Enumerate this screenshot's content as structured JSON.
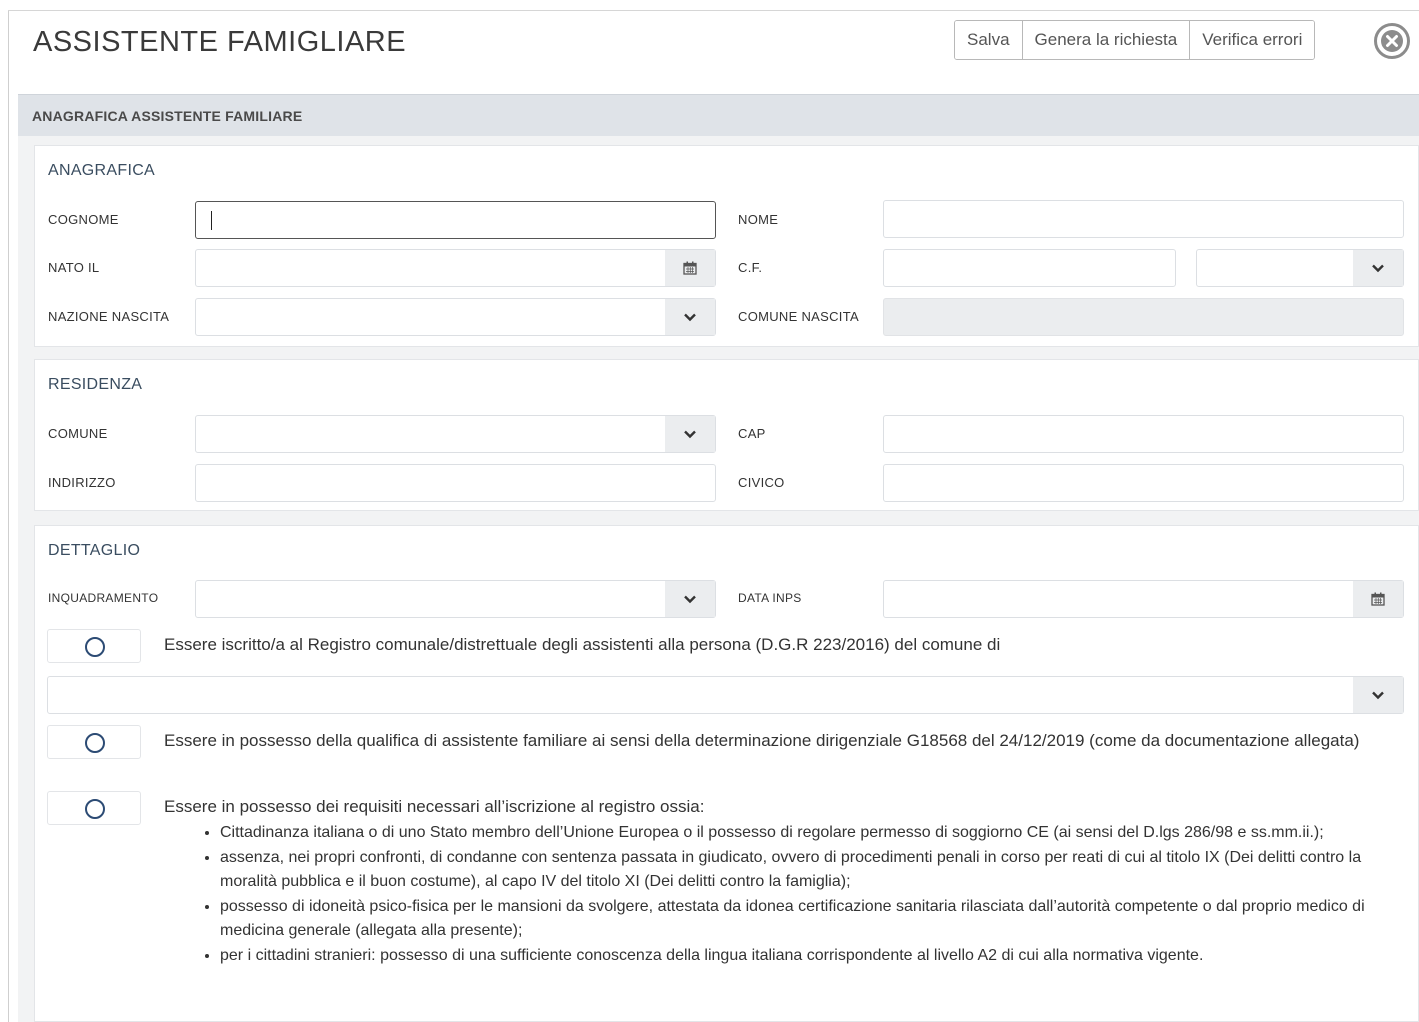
{
  "header": {
    "title": "ASSISTENTE FAMIGLIARE",
    "buttons": {
      "save": "Salva",
      "generate": "Genera la richiesta",
      "verify": "Verifica errori"
    }
  },
  "section": {
    "title": "ANAGRAFICA ASSISTENTE FAMILIARE"
  },
  "anagrafica": {
    "title": "ANAGRAFICA",
    "cognome_label": "COGNOME",
    "nome_label": "NOME",
    "nato_il_label": "NATO IL",
    "cf_label": "C.F.",
    "nazione_nascita_label": "NAZIONE NASCITA",
    "comune_nascita_label": "COMUNE NASCITA"
  },
  "residenza": {
    "title": "RESIDENZA",
    "comune_label": "COMUNE",
    "cap_label": "CAP",
    "indirizzo_label": "INDIRIZZO",
    "civico_label": "CIVICO"
  },
  "dettaglio": {
    "title": "DETTAGLIO",
    "inquadramento_label": "INQUADRAMENTO",
    "data_inps_label": "DATA INPS",
    "req1": "Essere iscritto/a al Registro comunale/distrettuale degli assistenti alla persona (D.G.R 223/2016) del comune di",
    "req2": "Essere in possesso della qualifica di assistente familiare ai sensi della determinazione dirigenziale G18568 del 24/12/2019 (come da documentazione allegata)",
    "req3": "Essere in possesso dei requisiti necessari all’iscrizione al registro ossia:",
    "req3_items": [
      "Cittadinanza italiana o di uno Stato membro dell’Unione Europea o il possesso di regolare permesso di soggiorno CE (ai sensi del D.lgs 286/98 e ss.mm.ii.);",
      "assenza, nei propri confronti, di condanne con sentenza passata in giudicato, ovvero di procedimenti penali in corso per reati di cui al titolo IX (Dei delitti contro la moralità pubblica e il buon costume), al capo IV del titolo XI (Dei delitti contro la famiglia);",
      "possesso di idoneità psico-fisica per le mansioni da svolgere, attestata da idonea certificazione sanitaria rilasciata dall’autorità competente o dal proprio medico di medicina generale (allegata alla presente);",
      "per i cittadini stranieri: possesso di una sufficiente conoscenza della lingua italiana corrispondente al livello A2 di cui alla normativa vigente."
    ]
  },
  "icons": {
    "close": "close-circle-icon",
    "calendar": "calendar-icon",
    "dropdown": "chevron-down-icon",
    "toggle": "radio-circle-icon"
  },
  "colors": {
    "section_bar": "#dfe3e8",
    "card_title": "#3a4d60",
    "toggle_circle": "#2c4b74",
    "addon_bg": "#ebedef"
  }
}
